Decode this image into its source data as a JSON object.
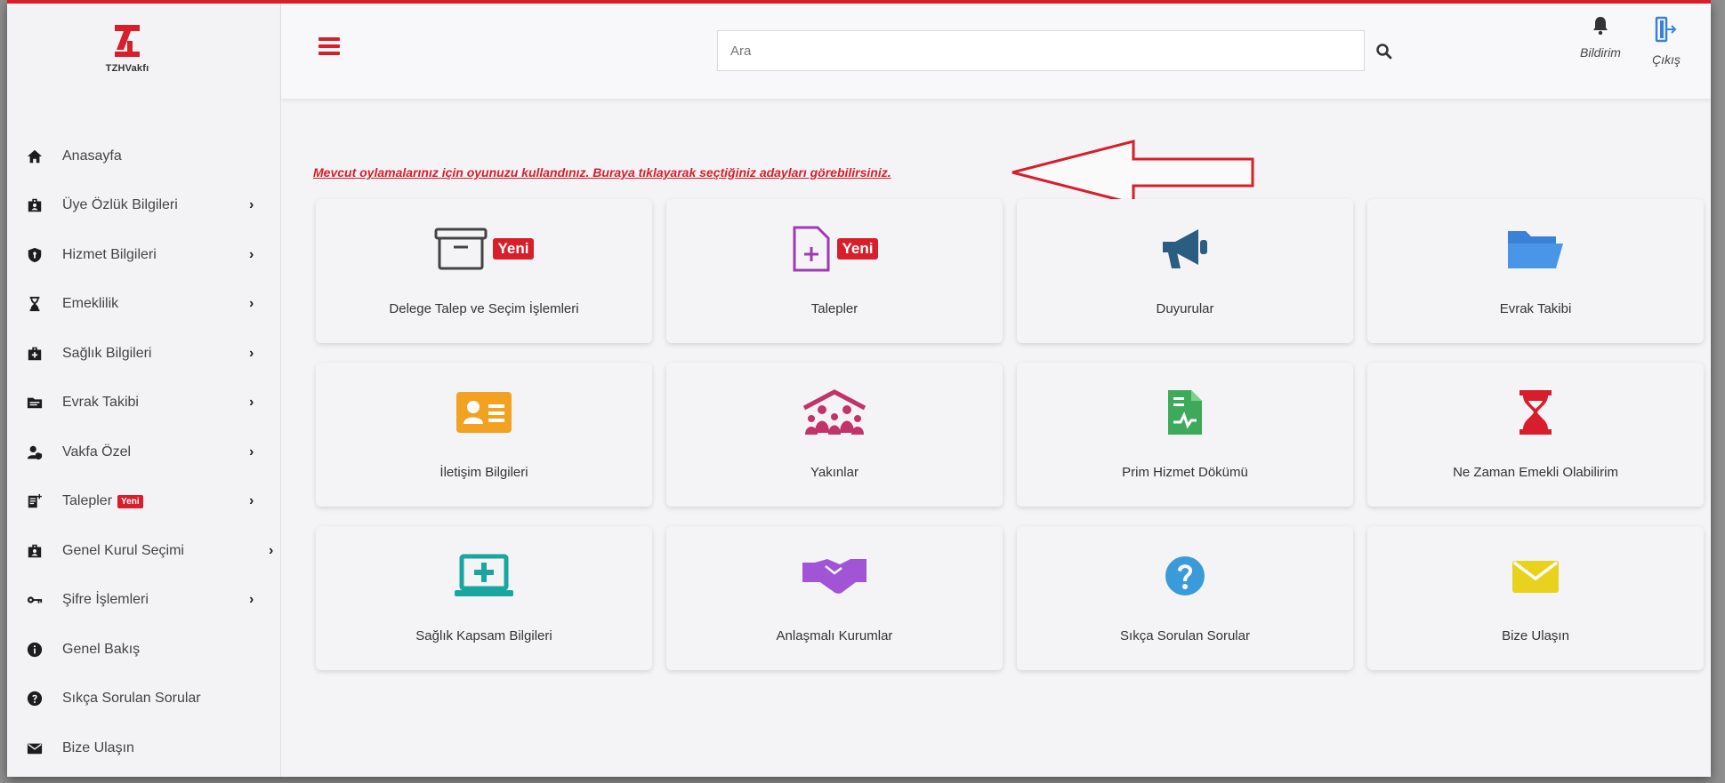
{
  "logo": {
    "text": "TZHVakfı"
  },
  "sidebar": {
    "items": [
      {
        "label": "Anasayfa",
        "icon": "home-icon",
        "chevron": false
      },
      {
        "label": "Üye Özlük Bilgileri",
        "icon": "id-badge-icon",
        "chevron": true
      },
      {
        "label": "Hizmet Bilgileri",
        "icon": "shield-icon",
        "chevron": true
      },
      {
        "label": "Emeklilik",
        "icon": "hourglass-icon",
        "chevron": true
      },
      {
        "label": "Sağlık Bilgileri",
        "icon": "medical-briefcase-icon",
        "chevron": true
      },
      {
        "label": "Evrak Takibi",
        "icon": "folder-icon",
        "chevron": true
      },
      {
        "label": "Vakfa Özel",
        "icon": "user-shield-icon",
        "chevron": true
      },
      {
        "label": "Talepler",
        "icon": "file-plus-icon",
        "chevron": true,
        "badge": "Yeni"
      },
      {
        "label": "Genel Kurul Seçimi",
        "icon": "ballot-icon",
        "chevron": true
      },
      {
        "label": "Şifre İşlemleri",
        "icon": "key-icon",
        "chevron": true
      },
      {
        "label": "Genel Bakış",
        "icon": "info-icon",
        "chevron": false
      },
      {
        "label": "Sıkça Sorulan Sorular",
        "icon": "question-icon",
        "chevron": false
      },
      {
        "label": "Bize Ulaşın",
        "icon": "envelope-icon",
        "chevron": false
      }
    ]
  },
  "header": {
    "search": {
      "placeholder": "Ara"
    },
    "notifications_label": "Bildirim",
    "logout_label": "Çıkış"
  },
  "notice": {
    "text": "Mevcut oylamalarınız için oyunuzu kullandınız. Buraya tıklayarak seçtiğiniz adayları görebilirsiniz."
  },
  "cards": [
    {
      "label": "Delege Talep ve Seçim İşlemleri",
      "icon": "archive-box-icon",
      "color": "#444444",
      "badge": "Yeni"
    },
    {
      "label": "Talepler",
      "icon": "file-plus-icon",
      "color": "#a03ab0",
      "badge": "Yeni"
    },
    {
      "label": "Duyurular",
      "icon": "megaphone-icon",
      "color": "#2b5d80"
    },
    {
      "label": "Evrak Takibi",
      "icon": "folder-open-icon",
      "color": "#3b82d6"
    },
    {
      "label": "İletişim Bilgileri",
      "icon": "contact-card-icon",
      "color": "#f2a121"
    },
    {
      "label": "Yakınlar",
      "icon": "family-house-icon",
      "color": "#c2336a"
    },
    {
      "label": "Prim Hizmet Dökümü",
      "icon": "document-chart-icon",
      "color": "#3daa5b"
    },
    {
      "label": "Ne Zaman Emekli Olabilirim",
      "icon": "hourglass-icon",
      "color": "#d81e2a"
    },
    {
      "label": "Sağlık Kapsam Bilgileri",
      "icon": "laptop-medical-icon",
      "color": "#1aa6a0"
    },
    {
      "label": "Anlaşmalı Kurumlar",
      "icon": "handshake-icon",
      "color": "#a155d6"
    },
    {
      "label": "Sıkça Sorulan Sorular",
      "icon": "question-circle-icon",
      "color": "#3b9ad9"
    },
    {
      "label": "Bize Ulaşın",
      "icon": "envelope-icon",
      "color": "#e8d21e"
    }
  ],
  "colors": {
    "accent": "#d81e2a",
    "background": "#f4f4f6"
  }
}
